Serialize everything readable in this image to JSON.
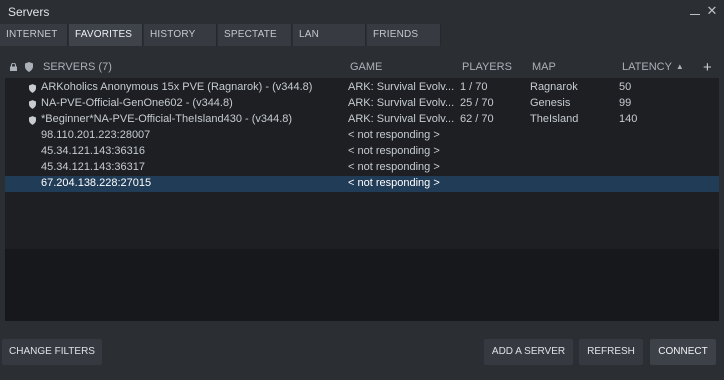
{
  "window": {
    "title": "Servers"
  },
  "tabs": [
    {
      "label": "INTERNET",
      "active": false
    },
    {
      "label": "FAVORITES",
      "active": true
    },
    {
      "label": "HISTORY",
      "active": false
    },
    {
      "label": "SPECTATE",
      "active": false
    },
    {
      "label": "LAN",
      "active": false
    },
    {
      "label": "FRIENDS",
      "active": false
    }
  ],
  "columns": {
    "servers": "SERVERS (7)",
    "game": "GAME",
    "players": "PLAYERS",
    "map": "MAP",
    "latency": "LATENCY",
    "sort_indicator": "▲"
  },
  "rows": [
    {
      "name": "ARKoholics Anonymous 15x PVE (Ragnarok) - (v344.8)",
      "game": "ARK: Survival Evolv...",
      "players": "1 / 70",
      "map": "Ragnarok",
      "latency": "50",
      "icon": "shield-icon",
      "selected": false
    },
    {
      "name": "NA-PVE-Official-GenOne602 - (v344.8)",
      "game": "ARK: Survival Evolv...",
      "players": "25 / 70",
      "map": "Genesis",
      "latency": "99",
      "icon": "shield-icon",
      "selected": false
    },
    {
      "name": "*Beginner*NA-PVE-Official-TheIsland430 - (v344.8)",
      "game": "ARK: Survival Evolv...",
      "players": "62 / 70",
      "map": "TheIsland",
      "latency": "140",
      "icon": "shield-icon",
      "selected": false
    },
    {
      "name": "98.110.201.223:28007",
      "game": "< not responding >",
      "players": "",
      "map": "",
      "latency": "",
      "icon": "",
      "selected": false
    },
    {
      "name": "45.34.121.143:36316",
      "game": "< not responding >",
      "players": "",
      "map": "",
      "latency": "",
      "icon": "",
      "selected": false
    },
    {
      "name": "45.34.121.143:36317",
      "game": "< not responding >",
      "players": "",
      "map": "",
      "latency": "",
      "icon": "",
      "selected": false
    },
    {
      "name": "67.204.138.228:27015",
      "game": "< not responding >",
      "players": "",
      "map": "",
      "latency": "",
      "icon": "",
      "selected": true
    }
  ],
  "buttons": {
    "change_filters": "CHANGE FILTERS",
    "add_server": "ADD A SERVER",
    "refresh": "REFRESH",
    "connect": "CONNECT"
  },
  "colors": {
    "background": "#2b2e33",
    "list_background": "#1d1f23",
    "selected_row": "#213c57",
    "active_tab": "#3f434a"
  }
}
